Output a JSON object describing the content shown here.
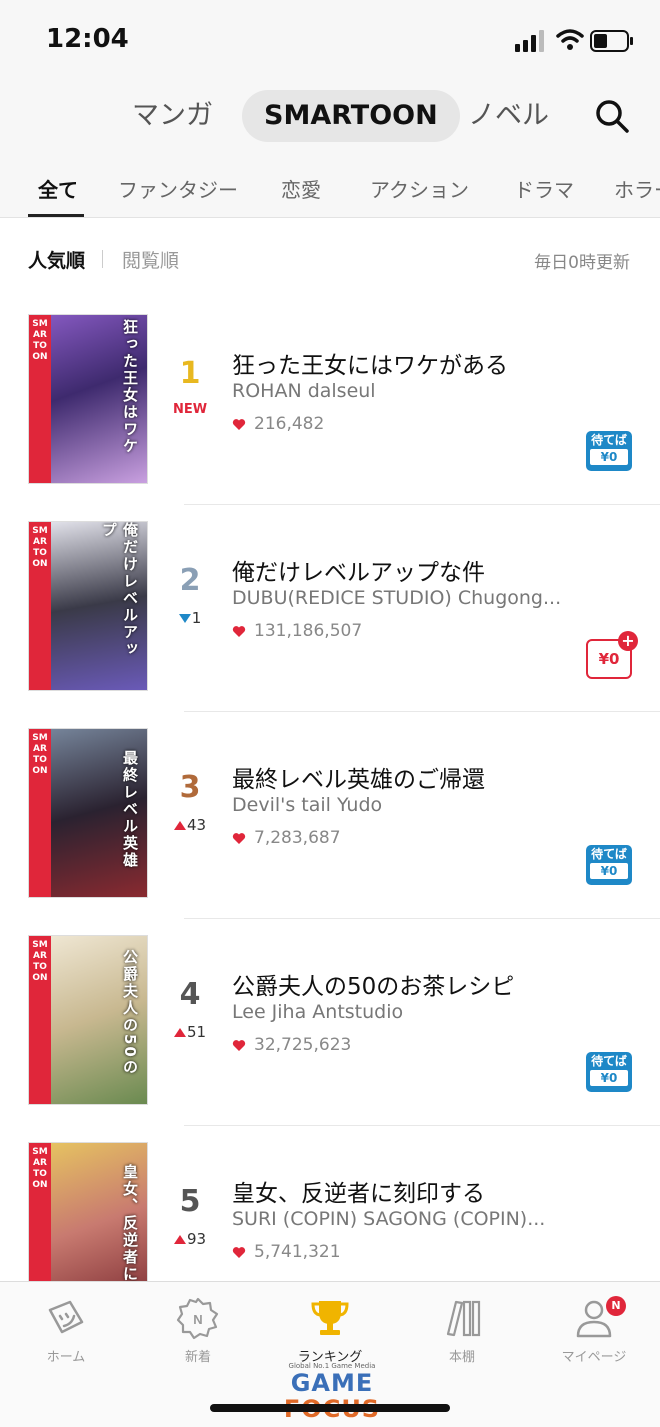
{
  "status": {
    "time": "12:04"
  },
  "top_tabs": [
    {
      "label": "マンガ"
    },
    {
      "label": "SMARTOON"
    },
    {
      "label": "ノベル"
    }
  ],
  "genres": [
    {
      "label": "全て"
    },
    {
      "label": "ファンタジー"
    },
    {
      "label": "恋愛"
    },
    {
      "label": "アクション"
    },
    {
      "label": "ドラマ"
    },
    {
      "label": "ホラー"
    }
  ],
  "sort": {
    "popular": "人気順",
    "views": "閲覧順",
    "update_note": "毎日0時更新"
  },
  "badges": {
    "wait_line1": "待てば",
    "wait_line2": "¥0",
    "free": "¥0",
    "plus": "+"
  },
  "cover_tag": "SMARTOON",
  "colors": {
    "accent_red": "#e0263a",
    "accent_blue": "#1e88c7",
    "gold": "#e8b820",
    "silver": "#8a9fb5",
    "bronze": "#b06a3a"
  },
  "items": [
    {
      "rank": "1",
      "change": "NEW",
      "title": "狂った王女にはワケがある",
      "author": "ROHAN dalseul",
      "likes": "216,482",
      "cover_text": "狂った王女はワケ"
    },
    {
      "rank": "2",
      "change": "1",
      "title": "俺だけレベルアップな件",
      "author": "DUBU(REDICE STUDIO) Chugong...",
      "likes": "131,186,507",
      "cover_text": "俺だけレベルアップ"
    },
    {
      "rank": "3",
      "change": "43",
      "title": "最終レベル英雄のご帰還",
      "author": "Devil's tail Yudo",
      "likes": "7,283,687",
      "cover_text": "最終レベル英雄"
    },
    {
      "rank": "4",
      "change": "51",
      "title": "公爵夫人の50のお茶レシピ",
      "author": "Lee Jiha Antstudio",
      "likes": "32,725,623",
      "cover_text": "公爵夫人の50の"
    },
    {
      "rank": "5",
      "change": "93",
      "title": "皇女、反逆者に刻印する",
      "author": "SURI (COPIN) SAGONG (COPIN)...",
      "likes": "5,741,321",
      "cover_text": "皇女、反逆者に"
    }
  ],
  "bottom_nav": [
    {
      "label": "ホーム",
      "icon": "home-icon"
    },
    {
      "label": "新着",
      "icon": "new-icon"
    },
    {
      "label": "ランキング",
      "icon": "trophy-icon"
    },
    {
      "label": "本棚",
      "icon": "bookshelf-icon"
    },
    {
      "label": "マイページ",
      "icon": "profile-icon",
      "badge": "N"
    }
  ],
  "watermark": {
    "small": "Global No.1 Game Media",
    "game": "GAME",
    "focus": "FOCUS"
  }
}
